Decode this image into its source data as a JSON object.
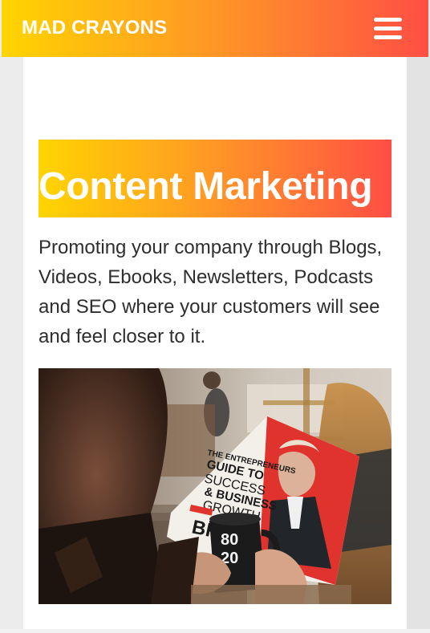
{
  "header": {
    "brand": "MAD CRAYONS",
    "menu_icon": "hamburger-menu-icon"
  },
  "hero": {
    "title": "Content Marketing",
    "description": "Promoting your company through Blogs, Videos, Ebooks, Newsletters, Podcasts and SEO where your customers will see and feel closer to it."
  },
  "photo": {
    "magazine_lines": [
      "THE ENTREPRENEURS",
      "GUIDE TO",
      "SUCCESS",
      "& BUSINESS",
      "GROWTH"
    ],
    "magazine_bottom": "BRA",
    "mug_text": [
      "80",
      "20"
    ]
  },
  "colors": {
    "gradient_start": "#ffd400",
    "gradient_end": "#ff4e44",
    "text": "#2e2e2e"
  }
}
